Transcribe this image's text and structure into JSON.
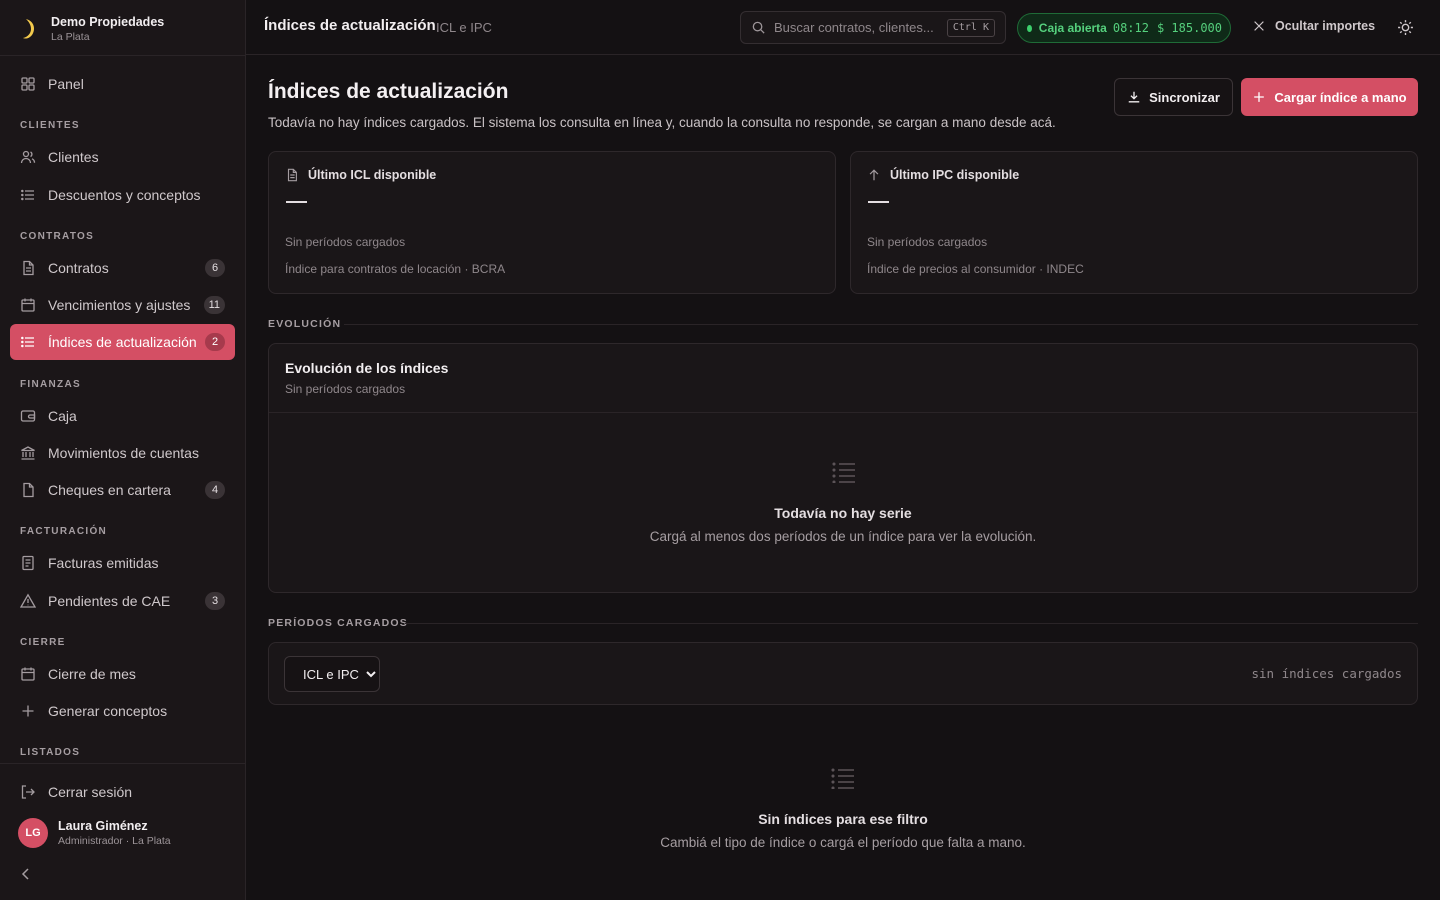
{
  "brand": {
    "name": "Demo Propiedades",
    "city": "La Plata"
  },
  "nav": {
    "panel": "Panel",
    "sections": {
      "clientes": "CLIENTES",
      "contratos": "CONTRATOS",
      "finanzas": "FINANZAS",
      "facturacion": "FACTURACIÓN",
      "cierre": "CIERRE",
      "listados": "LISTADOS"
    },
    "items": {
      "clientes": {
        "label": "Clientes"
      },
      "descuentos": {
        "label": "Descuentos y conceptos"
      },
      "contratos": {
        "label": "Contratos",
        "badge": "6"
      },
      "vencimientos": {
        "label": "Vencimientos y ajustes",
        "badge": "11"
      },
      "indices": {
        "label": "Índices de actualización",
        "badge": "2"
      },
      "caja": {
        "label": "Caja"
      },
      "movimientos": {
        "label": "Movimientos de cuentas"
      },
      "cheques": {
        "label": "Cheques en cartera",
        "badge": "4"
      },
      "facturas": {
        "label": "Facturas emitidas"
      },
      "pendientes": {
        "label": "Pendientes de CAE",
        "badge": "3"
      },
      "cierre_mes": {
        "label": "Cierre de mes"
      },
      "generar": {
        "label": "Generar conceptos"
      }
    },
    "logout": "Cerrar sesión"
  },
  "user": {
    "initials": "LG",
    "name": "Laura Giménez",
    "role": "Administrador · La Plata"
  },
  "topbar": {
    "title": "Índices de actualización",
    "subtitle": "ICL e IPC",
    "search_placeholder": "Buscar contratos, clientes...",
    "shortcut": "Ctrl K",
    "cash_label": "Caja abierta",
    "cash_time": "08:12",
    "cash_amount": "$ 185.000",
    "hide_amounts": "Ocultar importes"
  },
  "page": {
    "title": "Índices de actualización",
    "lead": "Todavía no hay índices cargados. El sistema los consulta en línea y, cuando la consulta no responde, se cargan a mano desde acá.",
    "sync_button": "Sincronizar",
    "load_button": "Cargar índice a mano"
  },
  "cards": {
    "icl": {
      "title": "Último ICL disponible",
      "status": "Sin períodos cargados",
      "desc": "Índice para contratos de locación · BCRA"
    },
    "ipc": {
      "title": "Último IPC disponible",
      "status": "Sin períodos cargados",
      "desc": "Índice de precios al consumidor · INDEC"
    }
  },
  "evolution": {
    "section": "EVOLUCIÓN",
    "title": "Evolución de los índices",
    "subtitle": "Sin períodos cargados",
    "empty_title": "Todavía no hay serie",
    "empty_sub": "Cargá al menos dos períodos de un índice para ver la evolución."
  },
  "periods": {
    "section": "PERÍODOS CARGADOS",
    "filter_value": "ICL e IPC",
    "filter_options": [
      "ICL e IPC"
    ],
    "note": "sin índices cargados",
    "empty_title": "Sin índices para ese filtro",
    "empty_sub": "Cambiá el tipo de índice o cargá el período que falta a mano."
  },
  "colors": {
    "accent": "#d44f64",
    "success": "#3ccf6c",
    "background": "#141113",
    "sidebar": "#1b1618"
  },
  "icons": [
    "grid-icon",
    "users-icon",
    "list-icon",
    "file-icon",
    "calendar-icon",
    "wallet-icon",
    "bank-icon",
    "receipt-icon",
    "alert-icon",
    "plus-icon",
    "logout-icon",
    "search-icon",
    "close-icon",
    "sun-icon",
    "download-icon",
    "arrow-up-icon",
    "chevron-left-icon"
  ]
}
